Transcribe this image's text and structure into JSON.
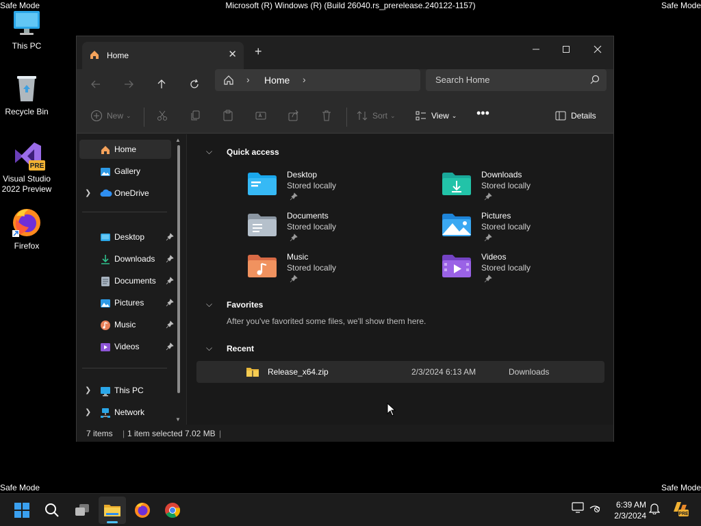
{
  "overlay": {
    "safe_mode_top_left": "Safe Mode",
    "safe_mode_top_right": "Safe Mode",
    "safe_mode_bottom_left": "Safe Mode",
    "safe_mode_bottom_right": "Safe Mode",
    "build": "Microsoft (R) Windows (R) (Build 26040.rs_prerelease.240122-1157)"
  },
  "desktop": {
    "icons": [
      {
        "label": "This PC",
        "icon": "monitor-icon"
      },
      {
        "label": "Recycle Bin",
        "icon": "recycle-bin-icon"
      },
      {
        "label": "Visual Studio 2022 Preview",
        "icon": "visual-studio-icon",
        "badge": "PRE"
      },
      {
        "label": "Firefox",
        "icon": "firefox-icon"
      }
    ]
  },
  "explorer": {
    "tab": {
      "label": "Home",
      "icon": "home-icon"
    },
    "address": {
      "crumb": "Home"
    },
    "search": {
      "placeholder": "Search Home"
    },
    "command_bar": {
      "new_label": "New",
      "sort_label": "Sort",
      "view_label": "View",
      "details_label": "Details"
    },
    "nav": {
      "top": [
        {
          "label": "Home",
          "icon": "home-icon",
          "selected": true
        },
        {
          "label": "Gallery",
          "icon": "gallery-icon"
        },
        {
          "label": "OneDrive",
          "icon": "cloud-icon",
          "expandable": true
        }
      ],
      "pinned": [
        {
          "label": "Desktop",
          "icon": "desktop-folder-icon"
        },
        {
          "label": "Downloads",
          "icon": "downloads-icon"
        },
        {
          "label": "Documents",
          "icon": "documents-icon"
        },
        {
          "label": "Pictures",
          "icon": "pictures-icon"
        },
        {
          "label": "Music",
          "icon": "music-icon"
        },
        {
          "label": "Videos",
          "icon": "videos-icon"
        }
      ],
      "bottom": [
        {
          "label": "This PC",
          "icon": "monitor-icon",
          "expandable": true
        },
        {
          "label": "Network",
          "icon": "network-icon",
          "expandable": true
        }
      ]
    },
    "sections": {
      "quick_access": "Quick access",
      "favorites": "Favorites",
      "favorites_empty": "After you've favorited some files, we'll show them here.",
      "recent": "Recent"
    },
    "quick_access": [
      {
        "name": "Desktop",
        "sub": "Stored locally",
        "color": "#1aa7ec"
      },
      {
        "name": "Downloads",
        "sub": "Stored locally",
        "color": "#1aa89a"
      },
      {
        "name": "Documents",
        "sub": "Stored locally",
        "color": "#9aa5b1"
      },
      {
        "name": "Pictures",
        "sub": "Stored locally",
        "color": "#2d9ae6"
      },
      {
        "name": "Music",
        "sub": "Stored locally",
        "color": "#e8815a"
      },
      {
        "name": "Videos",
        "sub": "Stored locally",
        "color": "#8d55d6"
      }
    ],
    "recent": [
      {
        "name": "Release_x64.zip",
        "date": "2/3/2024 6:13 AM",
        "location": "Downloads"
      }
    ],
    "status": {
      "items": "7 items",
      "selected": "1 item selected",
      "size": "7.02 MB"
    }
  },
  "taskbar": {
    "time": "6:39 AM",
    "date": "2/3/2024",
    "apps": [
      "start-icon",
      "search-icon",
      "task-view-icon",
      "file-explorer-icon",
      "firefox-icon",
      "chrome-icon"
    ],
    "active_app": "file-explorer-icon"
  }
}
